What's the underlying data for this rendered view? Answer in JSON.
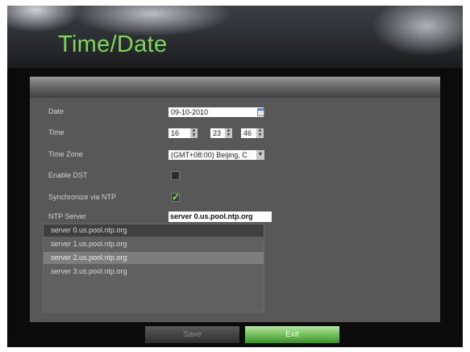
{
  "window": {
    "title": "Time/Date"
  },
  "form": {
    "date": {
      "label": "Date",
      "value": "09-10-2010"
    },
    "time": {
      "label": "Time",
      "hour": "16",
      "minute": "23",
      "second": "46"
    },
    "time_zone": {
      "label": "Time Zone",
      "value": "(GMT+08:00) Beijing, C"
    },
    "enable_dst": {
      "label": "Enable DST",
      "checked": false
    },
    "sync_ntp": {
      "label": "Synchronize via NTP",
      "checked": true,
      "check_glyph": "✓"
    },
    "ntp_server": {
      "label": "NTP Server",
      "value": "server 0.us.pool.ntp.org"
    }
  },
  "server_list": [
    {
      "text": "server 0.us.pool.ntp.org",
      "style": "dark"
    },
    {
      "text": "server 1.us.pool.ntp.org",
      "style": "none"
    },
    {
      "text": "server 2.us.pool.ntp.org",
      "style": "light"
    },
    {
      "text": "server 3.us.pool.ntp.org",
      "style": "none"
    }
  ],
  "buttons": {
    "save_label": "Save",
    "exit_label": "Exit"
  },
  "icons": {
    "spin": "spinner-arrows-icon",
    "calendar": "calendar-icon",
    "dropdown": "chevron-down-icon"
  },
  "colors": {
    "title": "#7dd94f",
    "exit_button": "#6ebd55",
    "checkmark": "#7cff3e"
  }
}
